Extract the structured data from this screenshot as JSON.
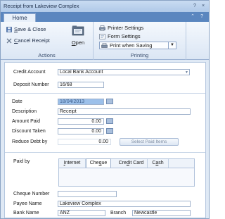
{
  "window": {
    "title": "Receipt from Lakeview Complex"
  },
  "titlebar_controls": {
    "help": "?",
    "close": "×"
  },
  "ribbon_tabs": {
    "home": "Home",
    "collapse": "⌃",
    "help": "?"
  },
  "ribbon": {
    "actions": {
      "save_close_prefix": "S",
      "save_close_rest": "ave & Close",
      "cancel_prefix": "C",
      "cancel_rest": "ancel Receipt",
      "open_prefix": "O",
      "open_rest": "pen",
      "group_label": "Actions"
    },
    "printing": {
      "printer_settings": "Printer Settings",
      "form_settings": "Form Settings",
      "print_option": "Print when Saving",
      "group_label": "Printing"
    }
  },
  "form": {
    "credit_account_label": "Credit Account",
    "credit_account_value": "Local Bank Account",
    "deposit_number_label": "Deposit Number",
    "deposit_number_value": "16/68",
    "date_label": "Date",
    "date_value": "18/04/2013",
    "description_label": "Description",
    "description_value": "Receipt",
    "amount_paid_label": "Amount Paid",
    "amount_paid_value": "0.00",
    "discount_taken_label": "Discount Taken",
    "discount_taken_value": "0.00",
    "reduce_debt_label": "Reduce Debt by",
    "reduce_debt_value": "0.00",
    "select_paid_items": "Select Paid Items",
    "paid_by_label": "Paid by",
    "pay_tabs": [
      {
        "prefix": "",
        "underline": "I",
        "rest": "nternet"
      },
      {
        "prefix": "Che",
        "underline": "q",
        "rest": "ue"
      },
      {
        "prefix": "Cre",
        "underline": "d",
        "rest": "it Card"
      },
      {
        "prefix": "C",
        "underline": "a",
        "rest": "sh"
      }
    ],
    "cheque_number_label": "Cheque Number",
    "cheque_number_value": "",
    "payee_name_label": "Payee Name",
    "payee_name_value": "Lakeview Complex",
    "bank_name_label": "Bank Name",
    "bank_name_value": "ANZ",
    "branch_label": "Branch",
    "branch_value": "Newcastle"
  },
  "colors": {
    "accent": "#5a86bf",
    "ribbon_bg": "#dbe6f4",
    "date_highlight": "#9cc0ea"
  }
}
